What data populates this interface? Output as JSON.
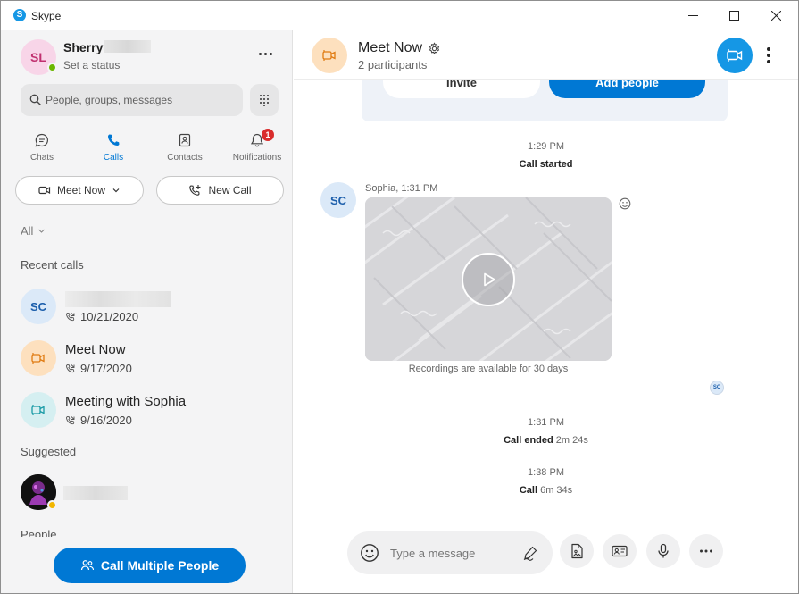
{
  "window": {
    "title": "Skype",
    "logo_letter": "S"
  },
  "profile": {
    "initials": "SL",
    "name": "Sherry",
    "status": "Set a status"
  },
  "search": {
    "placeholder": "People, groups, messages"
  },
  "nav_tabs": [
    {
      "label": "Chats"
    },
    {
      "label": "Calls"
    },
    {
      "label": "Contacts"
    },
    {
      "label": "Notifications",
      "badge": "1"
    }
  ],
  "actions": {
    "meet_now": "Meet Now",
    "new_call": "New Call"
  },
  "filter": {
    "label": "All"
  },
  "recent": {
    "title": "Recent calls",
    "items": [
      {
        "initials": "SC",
        "name": "",
        "date": "10/21/2020"
      },
      {
        "name": "Meet Now",
        "date": "9/17/2020"
      },
      {
        "name": "Meeting with Sophia",
        "date": "9/16/2020"
      }
    ]
  },
  "suggested": {
    "title": "Suggested"
  },
  "people": {
    "title": "People"
  },
  "call_multiple": {
    "label": "Call Multiple People"
  },
  "chat": {
    "title": "Meet Now",
    "participants": "2 participants",
    "invite_label": "Invite",
    "add_people_label": "Add people",
    "events": [
      {
        "time": "1:29 PM",
        "text": "Call started",
        "duration": ""
      },
      {
        "time": "1:31 PM",
        "text": "Call ended",
        "duration": "2m 24s"
      },
      {
        "time": "1:38 PM",
        "text": "Call",
        "duration": "6m 34s"
      }
    ],
    "message": {
      "initials": "SC",
      "sender": "Sophia, 1:31 PM",
      "note": "Recordings are available for 30 days",
      "read_initials": "SC"
    },
    "composer_placeholder": "Type a message"
  },
  "colors": {
    "accent": "#0078d4",
    "skype_blue": "#1597e5",
    "badge_red": "#d92c2c",
    "online_green": "#6bb700"
  }
}
